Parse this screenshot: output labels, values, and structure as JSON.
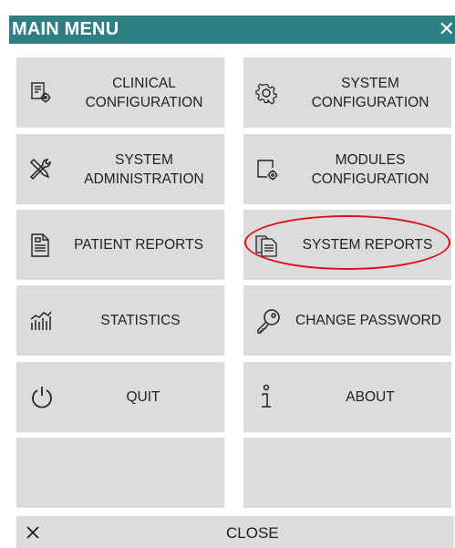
{
  "window": {
    "title": "MAIN MENU",
    "close_glyph": "✕"
  },
  "tiles": [
    {
      "label": "CLINICAL\nCONFIGURATION",
      "icon": "clinical-config-icon"
    },
    {
      "label": "SYSTEM\nCONFIGURATION",
      "icon": "gear-icon"
    },
    {
      "label": "SYSTEM\nADMINISTRATION",
      "icon": "tools-icon"
    },
    {
      "label": "MODULES\nCONFIGURATION",
      "icon": "modules-config-icon"
    },
    {
      "label": "PATIENT REPORTS",
      "icon": "document-icon"
    },
    {
      "label": "SYSTEM REPORTS",
      "icon": "reports-icon"
    },
    {
      "label": "STATISTICS",
      "icon": "statistics-icon"
    },
    {
      "label": "CHANGE PASSWORD",
      "icon": "key-icon"
    },
    {
      "label": "QUIT",
      "icon": "power-icon"
    },
    {
      "label": "ABOUT",
      "icon": "info-icon"
    },
    {
      "label": "",
      "icon": ""
    },
    {
      "label": "",
      "icon": ""
    }
  ],
  "close_bar": {
    "label": "CLOSE",
    "icon": "close-icon"
  },
  "colors": {
    "header": "#2e7f83",
    "tile": "#dcdcdc",
    "highlight": "#e0101a"
  }
}
